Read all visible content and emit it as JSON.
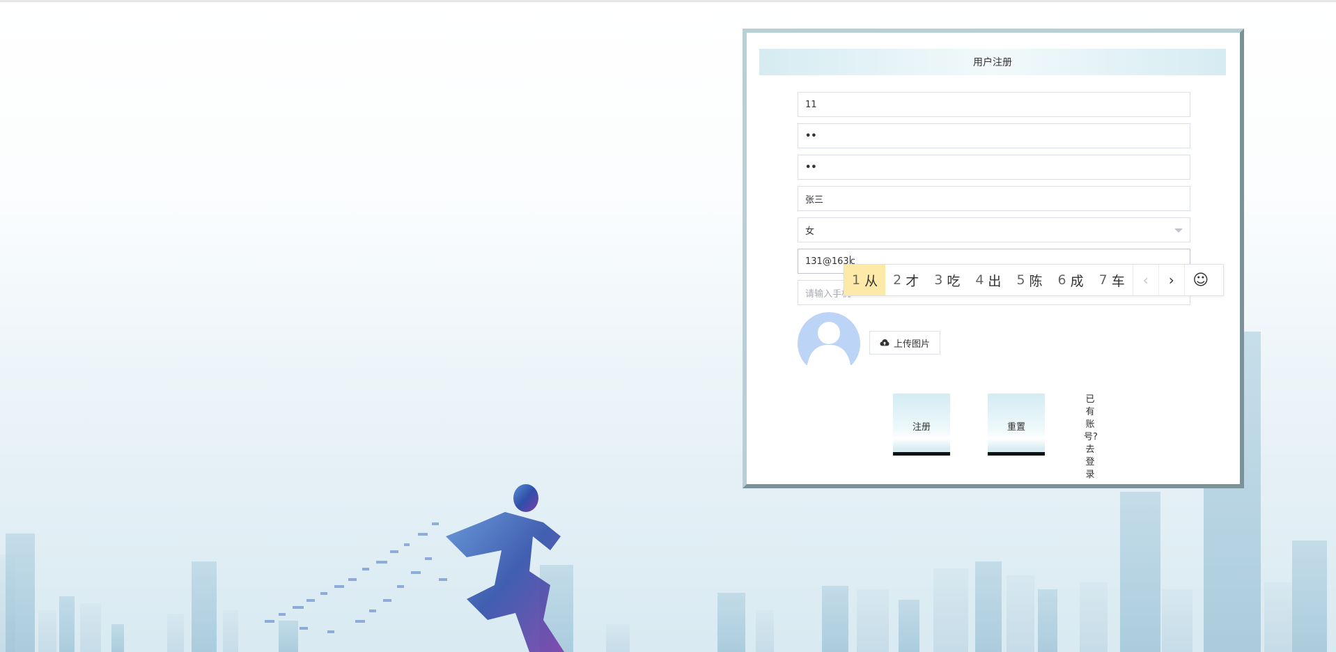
{
  "form": {
    "title": "用户注册",
    "username_value": "11",
    "password_value": "••",
    "confirm_password_value": "••",
    "name_value": "张三",
    "gender_value": "女",
    "email_value": "131@163",
    "email_composing": "c",
    "phone_placeholder": "请输入手机",
    "upload_label": "上传图片",
    "register_label": "注册",
    "reset_label": "重置",
    "login_link_label": "已有账号?去登录"
  },
  "ime": {
    "candidates": [
      {
        "num": "1",
        "text": "从"
      },
      {
        "num": "2",
        "text": "才"
      },
      {
        "num": "3",
        "text": "吃"
      },
      {
        "num": "4",
        "text": "出"
      },
      {
        "num": "5",
        "text": "陈"
      },
      {
        "num": "6",
        "text": "成"
      },
      {
        "num": "7",
        "text": "车"
      }
    ],
    "prev_icon": "chevron-left-icon",
    "next_icon": "chevron-right-icon",
    "emoji_icon": "smiley-icon",
    "selected_color": "#fde9a8"
  },
  "colors": {
    "panel_border": "#b8cfd6",
    "header_accent": "#d6ecf2",
    "avatar_color": "#bcd5f7"
  }
}
